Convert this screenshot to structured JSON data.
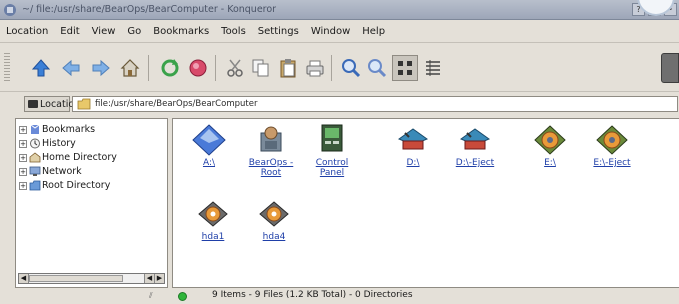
{
  "window": {
    "title": "~/ file:/usr/share/BearOps/BearComputer - Konqueror",
    "buttons": [
      "?",
      "•",
      "•"
    ]
  },
  "menu": [
    "Location",
    "Edit",
    "View",
    "Go",
    "Bookmarks",
    "Tools",
    "Settings",
    "Window",
    "Help"
  ],
  "toolbar": {
    "icons": [
      "up-arrow-icon",
      "back-arrow-icon",
      "forward-arrow-icon",
      "home-icon",
      "reload-icon",
      "stop-icon",
      "cut-icon",
      "copy-icon",
      "paste-icon",
      "print-icon",
      "zoom-in-icon",
      "zoom-out-icon",
      "icon-view-icon",
      "detail-view-icon"
    ]
  },
  "location": {
    "label": "Location",
    "value": "file:/usr/share/BearOps/BearComputer"
  },
  "sidebar": {
    "items": [
      {
        "label": "Bookmarks",
        "icon": "bookmarks-icon"
      },
      {
        "label": "History",
        "icon": "history-icon"
      },
      {
        "label": "Home Directory",
        "icon": "home-directory-icon"
      },
      {
        "label": "Network",
        "icon": "network-icon"
      },
      {
        "label": "Root Directory",
        "icon": "root-directory-icon"
      }
    ],
    "expander": "+"
  },
  "files": [
    {
      "label": "A:\\",
      "icon": "floppy-drive-icon"
    },
    {
      "label": "BearOps -Root",
      "icon": "root-terminal-icon"
    },
    {
      "label": "Control Panel",
      "icon": "control-panel-icon"
    },
    {
      "label": "D:\\",
      "icon": "network-drive-icon"
    },
    {
      "label": "D:\\-Eject",
      "icon": "network-drive-eject-icon"
    },
    {
      "label": "E:\\",
      "icon": "cdrom-drive-icon"
    },
    {
      "label": "E:\\-Eject",
      "icon": "cdrom-drive-eject-icon"
    },
    {
      "label": "hda1",
      "icon": "hard-disk-icon"
    },
    {
      "label": "hda4",
      "icon": "hard-disk-icon"
    }
  ],
  "status": {
    "text": "9 Items - 9 Files (1.2 KB Total) - 0 Directories"
  },
  "colors": {
    "link": "#1f3fa8",
    "status_led": "#2fb53a"
  }
}
